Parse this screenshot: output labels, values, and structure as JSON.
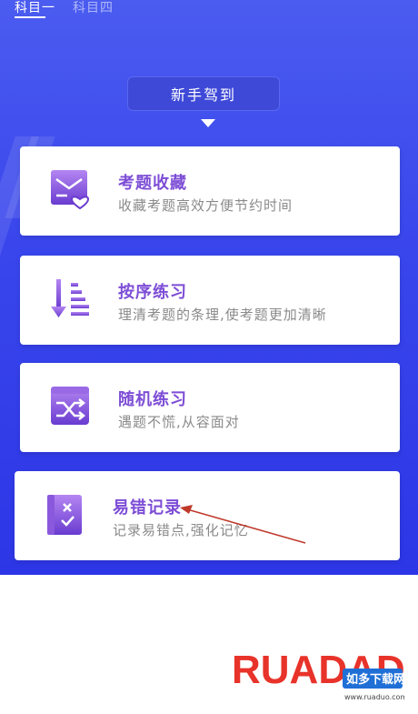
{
  "tabs": [
    {
      "label": "科目一",
      "active": true
    },
    {
      "label": "科目四",
      "active": false
    }
  ],
  "checkin_label": "新手驾到",
  "cards": [
    {
      "title": "考题收藏",
      "desc": "收藏考题高效方便节约时间",
      "icon": "favorites-icon"
    },
    {
      "title": "按序练习",
      "desc": "理清考题的条理,使考题更加清晰",
      "icon": "sequence-icon"
    },
    {
      "title": "随机练习",
      "desc": "遇题不慌,从容面对",
      "icon": "shuffle-icon"
    },
    {
      "title": "易错记录",
      "desc": "记录易错点,强化记忆",
      "icon": "error-record-icon"
    }
  ],
  "watermark": {
    "brand": "RUADADO",
    "cn": "如多下载网",
    "url": "www.ruaduo.com"
  },
  "colors": {
    "accent": "#7d4dd6",
    "background_top": "#4b5cf0",
    "background_bottom": "#2d36e6",
    "annotation": "#c0392b"
  }
}
